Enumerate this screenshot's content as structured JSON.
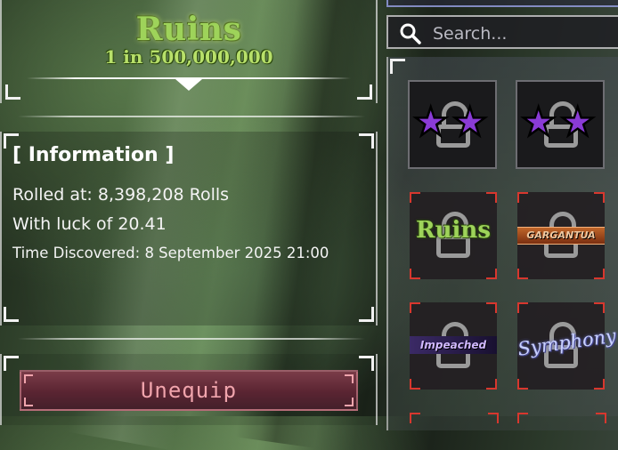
{
  "aura": {
    "name": "Ruins",
    "odds": "1 in 500,000,000"
  },
  "info": {
    "title": "[ Information ]",
    "rolled_at": "Rolled at: 8,398,208 Rolls",
    "luck": "With luck of 20.41",
    "time_discovered": "Time Discovered: 8 September 2025 21:00"
  },
  "unequip_label": "Unequip",
  "search": {
    "placeholder": "Search..."
  },
  "grid": {
    "slots": [
      {
        "kind": "locked-star",
        "label": "",
        "border_color": "#6d6d72"
      },
      {
        "kind": "locked-star",
        "label": "",
        "border_color": "#6d6d72"
      },
      {
        "kind": "aura",
        "label": "Ruins",
        "border_color": "#d8372e",
        "label_color": "#9ed35a"
      },
      {
        "kind": "aura",
        "label": "GARGANTUA",
        "border_color": "#d8372e",
        "label_color": "#f0c8a0"
      },
      {
        "kind": "aura",
        "label": "Impeached",
        "border_color": "#d8372e",
        "label_color": "#d0b8ff"
      },
      {
        "kind": "aura",
        "label": "Symphony",
        "border_color": "#d8372e",
        "label_color": "#c8d0ff"
      }
    ]
  },
  "colors": {
    "aura_green": "#9ed35a",
    "button_bg": "#5a2432",
    "button_text": "#f0a4ac",
    "slot_border_red": "#d8372e",
    "star_purple": "#8a3bd6"
  }
}
